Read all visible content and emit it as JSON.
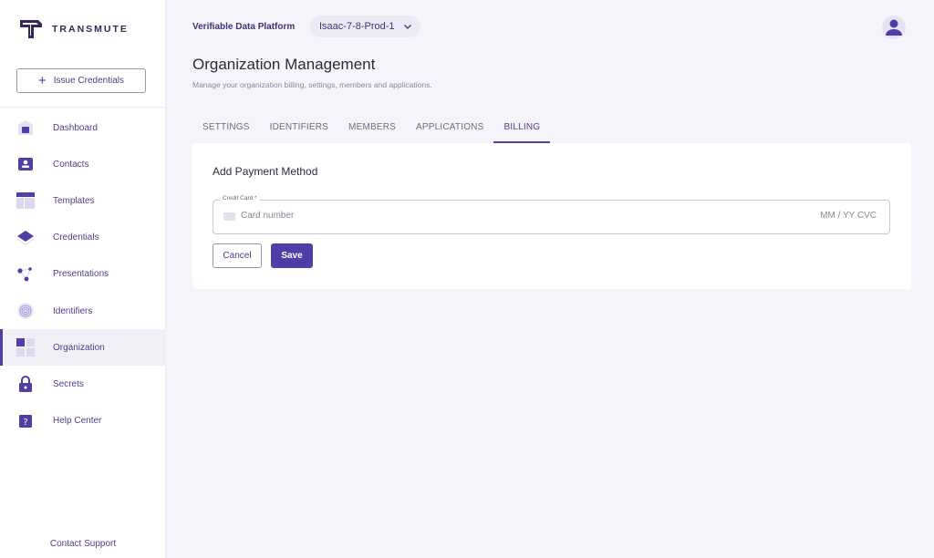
{
  "brand": {
    "name": "TRANSMUTE"
  },
  "sidebar": {
    "issue_label": "Issue Credentials",
    "items": [
      {
        "label": "Dashboard",
        "icon": "home-icon"
      },
      {
        "label": "Contacts",
        "icon": "contact-card-icon"
      },
      {
        "label": "Templates",
        "icon": "template-icon"
      },
      {
        "label": "Credentials",
        "icon": "credential-icon"
      },
      {
        "label": "Presentations",
        "icon": "presentation-icon"
      },
      {
        "label": "Identifiers",
        "icon": "fingerprint-icon"
      },
      {
        "label": "Organization",
        "icon": "organization-icon",
        "active": true
      },
      {
        "label": "Secrets",
        "icon": "lock-icon"
      },
      {
        "label": "Help Center",
        "icon": "help-icon"
      }
    ],
    "support_label": "Contact Support"
  },
  "header": {
    "platform": "Verifiable Data Platform",
    "environment": "Isaac-7-8-Prod-1"
  },
  "page": {
    "title": "Organization Management",
    "subtitle": "Manage your organization billing, settings, members and applications."
  },
  "tabs": [
    "SETTINGS",
    "IDENTIFIERS",
    "MEMBERS",
    "APPLICATIONS",
    "BILLING"
  ],
  "active_tab": "BILLING",
  "form": {
    "title": "Add Payment Method",
    "field_label": "Credit Card *",
    "card_placeholder": "Card number",
    "expiry_placeholder": "MM / YY  CVC",
    "cancel_label": "Cancel",
    "save_label": "Save"
  },
  "colors": {
    "accent": "#4f3da8",
    "nav_text": "#4a3f8e",
    "background": "#f5f4fa"
  }
}
